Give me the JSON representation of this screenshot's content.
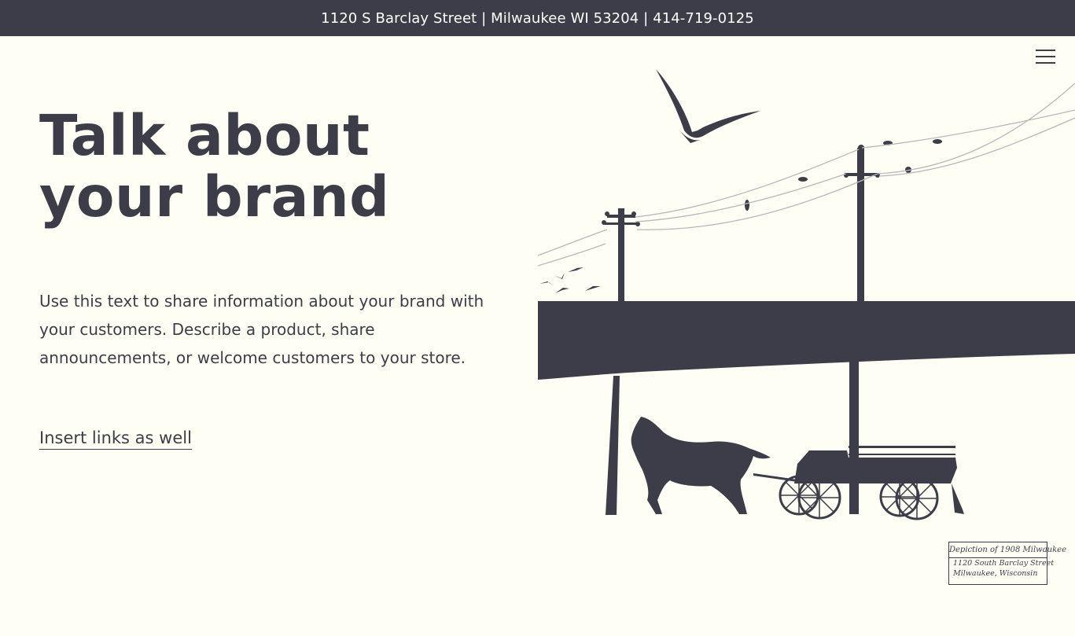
{
  "announcement": {
    "text": "1120 S Barclay Street | Milwaukee WI 53204 | 414-719-0125"
  },
  "header": {
    "menu_icon": "hamburger-menu-icon"
  },
  "hero": {
    "title": "Talk about your brand",
    "body": "Use this text to share information about your brand with your customers. Describe a product, share announcements, or welcome customers to your store.",
    "link_label": "Insert links as well"
  },
  "illustration": {
    "subject": "1908 Milwaukee street scene silhouette",
    "ink_color": "#3c3d48",
    "background_color": "#fefef4"
  },
  "plaque": {
    "heading": "Depiction of 1908 Milwaukee",
    "line1": "1120 South Barclay Street",
    "line2": "Milwaukee, Wisconsin"
  }
}
